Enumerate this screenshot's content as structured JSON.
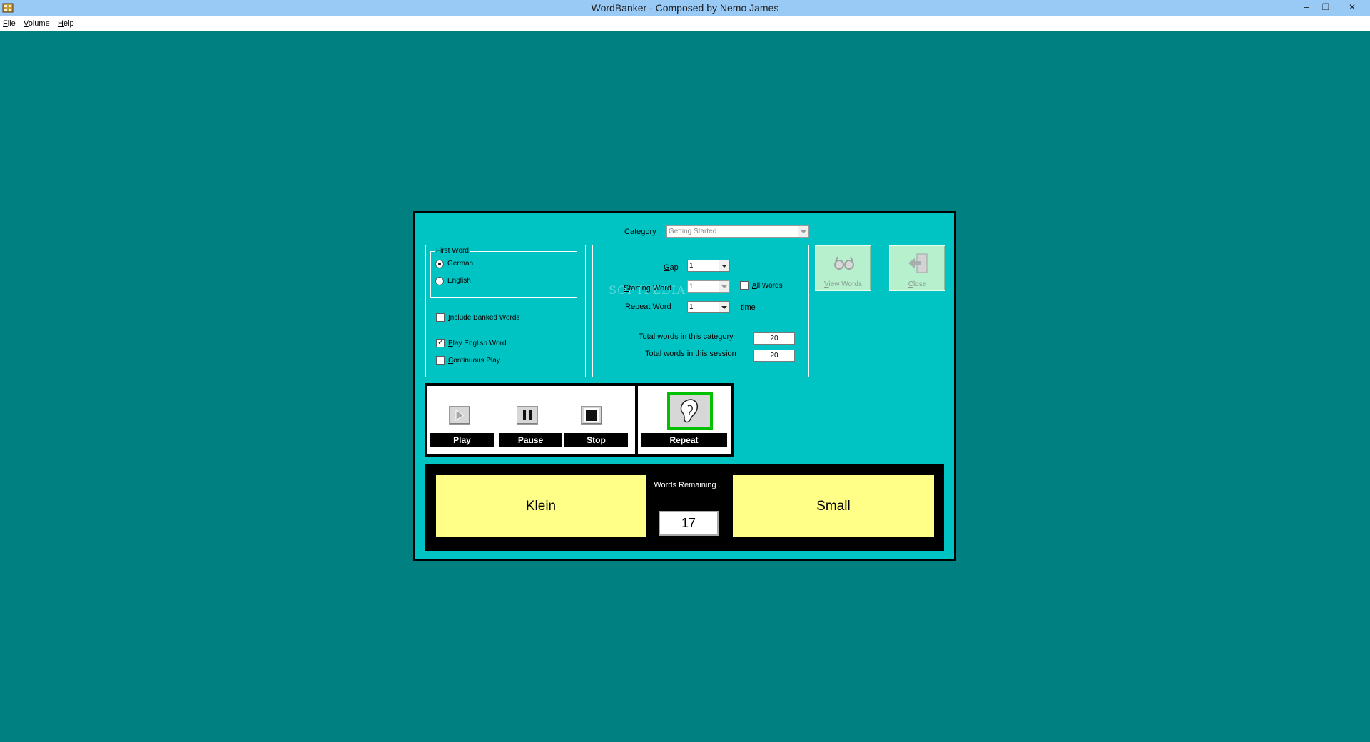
{
  "window": {
    "title": "WordBanker - Composed by Nemo James",
    "controls": {
      "minimize": "‒",
      "restore": "❐",
      "close": "✕"
    }
  },
  "menu": [
    "File",
    "Volume",
    "Help"
  ],
  "form": {
    "category_label": "Category",
    "category_value": "Getting Started",
    "first_word": {
      "legend": "First Word",
      "options": [
        {
          "label": "German",
          "checked": true
        },
        {
          "label": "English",
          "checked": false
        }
      ]
    },
    "checkboxes": [
      {
        "label": "Include Banked Words",
        "checked": false
      },
      {
        "label": "Play English Word",
        "checked": true
      },
      {
        "label": "Continuous Play",
        "checked": false
      }
    ],
    "gap_label": "Gap",
    "gap_value": "1",
    "starting_word_label": "Starting Word",
    "starting_word_value": "1",
    "all_words_label": "All Words",
    "repeat_word_label": "Repeat Word",
    "repeat_word_value": "1",
    "repeat_word_suffix": "time",
    "total_category_label": "Total words in this category",
    "total_category_value": "20",
    "total_session_label": "Total words in this session",
    "total_session_value": "20",
    "watermark": "SOFTPEDIA"
  },
  "buttons": {
    "view_words": "View Words",
    "close": "Close"
  },
  "media": {
    "play": "Play",
    "pause": "Pause",
    "stop": "Stop",
    "repeat": "Repeat"
  },
  "words": {
    "german": "Klein",
    "english": "Small",
    "remaining_label": "Words Remaining",
    "remaining_value": "17"
  },
  "colors": {
    "desktop": "#008080",
    "panel": "#00c4c4",
    "word_panel": "#ffff88",
    "repeat_highlight": "#00c000"
  }
}
